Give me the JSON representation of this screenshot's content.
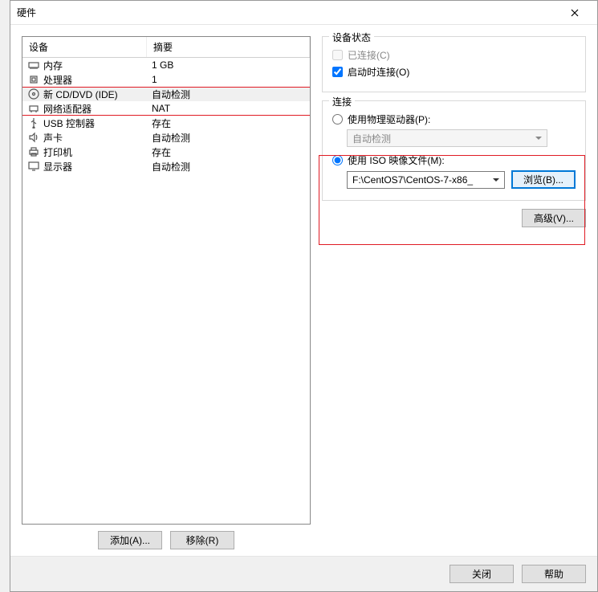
{
  "window": {
    "title": "硬件"
  },
  "left": {
    "header_device": "设备",
    "header_summary": "摘要",
    "rows": [
      {
        "device": "内存",
        "summary": "1 GB"
      },
      {
        "device": "处理器",
        "summary": "1"
      },
      {
        "device": "新 CD/DVD (IDE)",
        "summary": "自动检测"
      },
      {
        "device": "网络适配器",
        "summary": "NAT"
      },
      {
        "device": "USB 控制器",
        "summary": "存在"
      },
      {
        "device": "声卡",
        "summary": "自动检测"
      },
      {
        "device": "打印机",
        "summary": "存在"
      },
      {
        "device": "显示器",
        "summary": "自动检测"
      }
    ],
    "add_button": "添加(A)...",
    "remove_button": "移除(R)"
  },
  "right": {
    "status": {
      "legend": "设备状态",
      "connected": "已连接(C)",
      "connect_at_power": "启动时连接(O)"
    },
    "connection": {
      "legend": "连接",
      "physical_drive": "使用物理驱动器(P):",
      "auto_detect": "自动检测",
      "use_iso": "使用 ISO 映像文件(M):",
      "iso_path": "F:\\CentOS7\\CentOS-7-x86_",
      "browse": "浏览(B)..."
    },
    "advanced": "高级(V)..."
  },
  "footer": {
    "close": "关闭",
    "help": "帮助"
  }
}
